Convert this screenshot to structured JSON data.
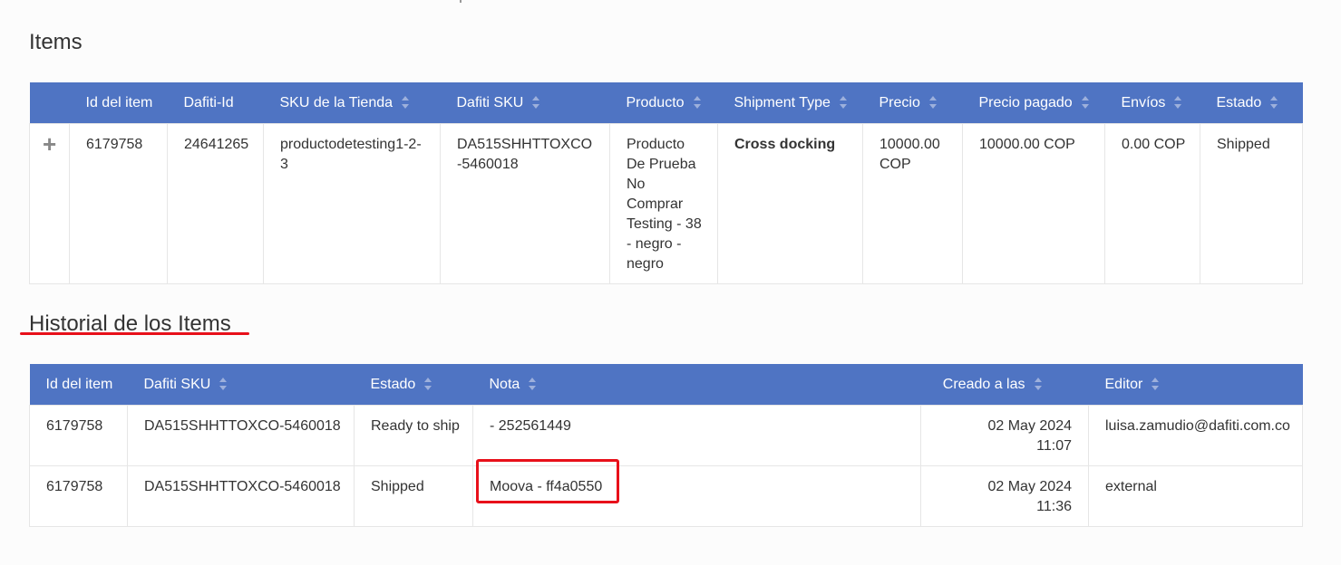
{
  "items": {
    "title": "Items",
    "columns": [
      "Id del item",
      "Dafiti-Id",
      "SKU de la Tienda",
      "Dafiti SKU",
      "Producto",
      "Shipment Type",
      "Precio",
      "Precio pagado",
      "Envíos",
      "Estado"
    ],
    "rows": [
      {
        "expand_icon": "+",
        "id": "6179758",
        "dafiti_id": "24641265",
        "sku_tienda": "productodetesting1-2-3",
        "dafiti_sku": "DA515SHHTTOXCO-5460018",
        "producto": "Producto De Prueba No Comprar Testing - 38 - negro - negro",
        "shipment_type": "Cross docking",
        "precio": "10000.00 COP",
        "precio_pagado": "10000.00 COP",
        "envios": "0.00 COP",
        "estado": "Shipped"
      }
    ]
  },
  "history": {
    "title": "Historial de los Items",
    "columns": [
      "Id del item",
      "Dafiti SKU",
      "Estado",
      "Nota",
      "Creado a las",
      "Editor"
    ],
    "rows": [
      {
        "id": "6179758",
        "dafiti_sku": "DA515SHHTTOXCO-5460018",
        "estado": "Ready to ship",
        "nota": "- 252561449",
        "creado_date": "02 May 2024",
        "creado_time": "11:07",
        "editor": "luisa.zamudio@dafiti.com.co"
      },
      {
        "id": "6179758",
        "dafiti_sku": "DA515SHHTTOXCO-5460018",
        "estado": "Shipped",
        "nota": "Moova - ff4a0550",
        "creado_date": "02 May 2024",
        "creado_time": "11:36",
        "editor": "external"
      }
    ]
  },
  "colors": {
    "header_bg": "#4f74c3",
    "annotation": "#e8101a"
  }
}
